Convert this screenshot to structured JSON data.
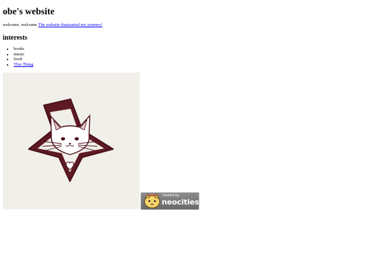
{
  "page": {
    "title": "obe's website",
    "intro_text": "welcome, welcome ",
    "intro_link": "The website thatstarted my journey!",
    "section_heading": "interests",
    "interests": [
      "books",
      "music",
      "food"
    ],
    "interest_link": "This Thing"
  },
  "image": {
    "description_icon": "cat-in-star-icon",
    "background": "#f1efea",
    "star_color": "#5e1a24"
  },
  "badge": {
    "small_text": "hosted by",
    "big_text": "neocities",
    "icon": "neocities-cat-icon"
  }
}
